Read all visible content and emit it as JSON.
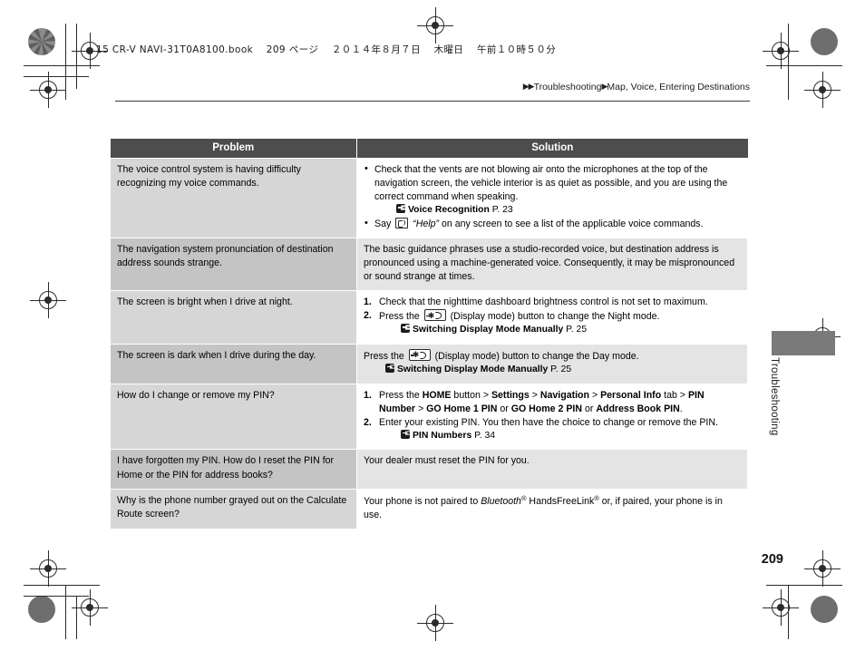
{
  "slug": {
    "text": "15 CR-V NAVI-31T0A8100.book 　209 ページ 　２０１４年８月７日 　木曜日 　午前１０時５０分"
  },
  "running_head": {
    "arrow": "▶▶",
    "section": "Troubleshooting",
    "arrow2": "▶",
    "subsection": "Map, Voice, Entering Destinations"
  },
  "side_tab": {
    "label": "Troubleshooting"
  },
  "page_number": "209",
  "table": {
    "headers": {
      "problem": "Problem",
      "solution": "Solution"
    },
    "rows": [
      {
        "problem": "The voice control system is having difficulty recognizing my voice commands.",
        "bullets": [
          "Check that the vents are not blowing air onto the microphones at the top of the navigation screen, the vehicle interior is as quiet as possible, and you are using the correct command when speaking.",
          "Say"
        ],
        "bullet2_rest": "on any screen to see a list of the applicable voice commands.",
        "bullet2_quote": "“Help”",
        "xref": {
          "name": "Voice Recognition",
          "page": "P. 23"
        }
      },
      {
        "problem": "The navigation system pronunciation of destination address sounds strange.",
        "solution": "The basic guidance phrases use a studio-recorded voice, but destination address is pronounced using a machine-generated voice. Consequently, it may be mispronounced or sound strange at times."
      },
      {
        "problem": "The screen is bright when I drive at night.",
        "steps": [
          "Check that the nighttime dashboard brightness control is not set to maximum.",
          "Press the"
        ],
        "step2_rest": "(Display mode) button to change the Night mode.",
        "xref": {
          "name": "Switching Display Mode Manually",
          "page": "P. 25"
        }
      },
      {
        "problem": "The screen is dark when I drive during the day.",
        "lead": "Press the",
        "rest": "(Display mode) button to change the Day mode.",
        "xref": {
          "name": "Switching Display Mode Manually",
          "page": "P. 25"
        }
      },
      {
        "problem": "How do I change or remove my PIN?",
        "step1": {
          "pre": "Press the ",
          "home": "HOME",
          "mid1": " button > ",
          "settings": "Settings",
          "gt1": " > ",
          "navigation": "Navigation",
          "gt2": " > ",
          "personal_info": "Personal Info",
          "tab": " tab > ",
          "pin_number": "PIN Number",
          "gt3": " > ",
          "go_home_1": "GO Home 1 PIN",
          "or1": " or ",
          "go_home_2": "GO Home 2 PIN",
          "or2": " or ",
          "address_book": "Address Book PIN",
          "end": "."
        },
        "step2": "Enter your existing PIN. You then have the choice to change or remove the PIN.",
        "xref": {
          "name": "PIN Numbers",
          "page": "P. 34"
        }
      },
      {
        "problem": "I have forgotten my PIN. How do I reset the PIN for Home or the PIN for address books?",
        "solution": "Your dealer must reset the PIN for you."
      },
      {
        "problem": "Why is the phone number grayed out on the Calculate Route screen?",
        "solution_parts": {
          "pre": "Your phone is not paired to ",
          "bluetooth": "Bluetooth",
          "sup1": "®",
          "mid": " HandsFreeLink",
          "sup2": "®",
          "post": " or, if paired, your phone is in use."
        }
      }
    ]
  }
}
